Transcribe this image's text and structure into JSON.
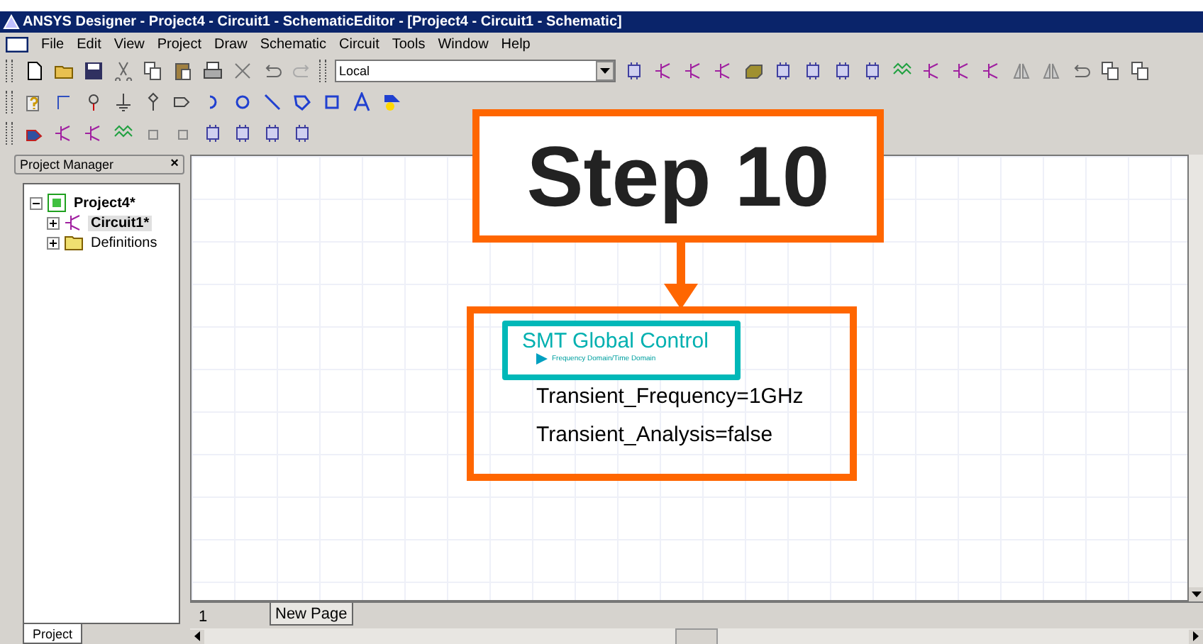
{
  "window": {
    "title": "ANSYS Designer - Project4 - Circuit1 - SchematicEditor - [Project4 - Circuit1 - Schematic]"
  },
  "menu": [
    "File",
    "Edit",
    "View",
    "Project",
    "Draw",
    "Schematic",
    "Circuit",
    "Tools",
    "Window",
    "Help"
  ],
  "toolbar": {
    "design_selector": "Local"
  },
  "project_manager": {
    "title": "Project Manager",
    "close": "×",
    "tree": [
      {
        "label": "Project4*",
        "kind": "project",
        "bold": true,
        "selected": false,
        "expanded": true,
        "children": [
          {
            "label": "Circuit1*",
            "kind": "circuit",
            "bold": true,
            "selected": true,
            "expanded": false
          },
          {
            "label": "Definitions",
            "kind": "folder",
            "bold": false,
            "selected": false,
            "expanded": false
          }
        ]
      }
    ],
    "tabs": [
      {
        "label": "Project",
        "selected": true
      }
    ]
  },
  "schematic": {
    "component": {
      "title": "SMT Global Control",
      "subtitle": "Frequency Domain/Time Domain",
      "properties": [
        "Transient_Frequency=1GHz",
        "Transient_Analysis=false"
      ]
    },
    "page_number": "1",
    "page_tabs": [
      {
        "label": "New Page",
        "selected": true
      }
    ]
  },
  "callout": {
    "text": "Step 10"
  }
}
